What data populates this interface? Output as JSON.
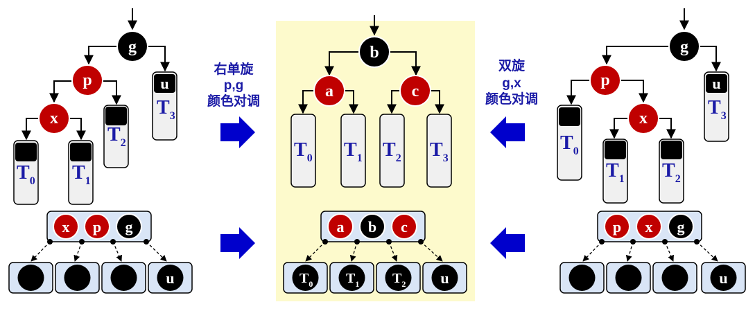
{
  "colors": {
    "red_node": "#c00000",
    "black_node": "#000000",
    "label_blue": "#1a1aa6",
    "arrow_blue": "#0000cc",
    "highlight_bg": "#fdfacc",
    "box_fill": "#d9e5f6",
    "subtree_fill": "#f0f0f0"
  },
  "left": {
    "nodes": {
      "g": "g",
      "p": "p",
      "x": "x"
    },
    "subtrees": {
      "t0": "T",
      "t0_sub": "0",
      "t1": "T",
      "t1_sub": "1",
      "t2": "T",
      "t2_sub": "2",
      "t3": "T",
      "t3_sub": "3"
    },
    "u_label": "u",
    "group": [
      "x",
      "p",
      "g"
    ],
    "bottom_last": "u"
  },
  "arrow_label_left": {
    "line1": "右单旋",
    "line2": "p,g",
    "line3": "颜色对调"
  },
  "middle": {
    "nodes": {
      "b": "b",
      "a": "a",
      "c": "c"
    },
    "subtrees": {
      "t0": "T",
      "t0_sub": "0",
      "t1": "T",
      "t1_sub": "1",
      "t2": "T",
      "t2_sub": "2",
      "t3": "T",
      "t3_sub": "3"
    },
    "group": [
      "a",
      "b",
      "c"
    ],
    "bottom": {
      "b0": "T",
      "b0_sub": "0",
      "b1": "T",
      "b1_sub": "1",
      "b2": "T",
      "b2_sub": "2",
      "b3": "u"
    }
  },
  "arrow_label_right": {
    "line1": "双旋",
    "line2": "g,x",
    "line3": "颜色对调"
  },
  "right": {
    "nodes": {
      "g": "g",
      "p": "p",
      "x": "x"
    },
    "subtrees": {
      "t0": "T",
      "t0_sub": "0",
      "t1": "T",
      "t1_sub": "1",
      "t2": "T",
      "t2_sub": "2",
      "t3": "T",
      "t3_sub": "3"
    },
    "u_label": "u",
    "group": [
      "p",
      "x",
      "g"
    ],
    "bottom_last": "u"
  }
}
